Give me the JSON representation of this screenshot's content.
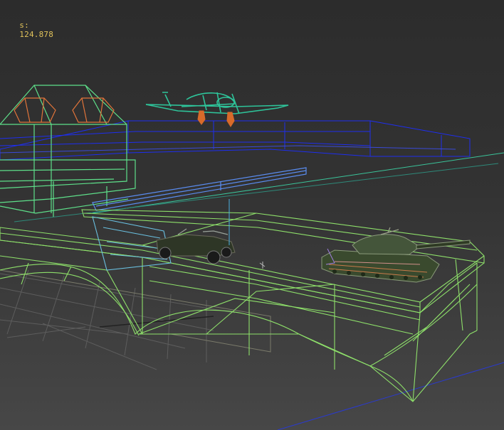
{
  "viewport": {
    "fps_label": "s:",
    "fps_value": "124.878"
  },
  "colors": {
    "background_top": "#2c2c2c",
    "background_bottom": "#474747",
    "grid": "#5a5a5a",
    "bridge_wire": "#8ee06a",
    "building_wire": "#5ee08a",
    "roof_detail": "#e0743a",
    "blue_wire": "#1e2ef0",
    "rail": "#5a8cf0",
    "plane": "#2ec49a",
    "plane_gear": "#d86a2a",
    "tank_body": "#3a4a2e",
    "jeep_body": "#2e3626",
    "readout_text": "#e0c25a"
  },
  "objects": [
    "ground-grid",
    "blue-terrain-wireframe",
    "building-wireframe",
    "bridge-wireframe",
    "aircraft-model",
    "tank-model",
    "jeep-model"
  ]
}
